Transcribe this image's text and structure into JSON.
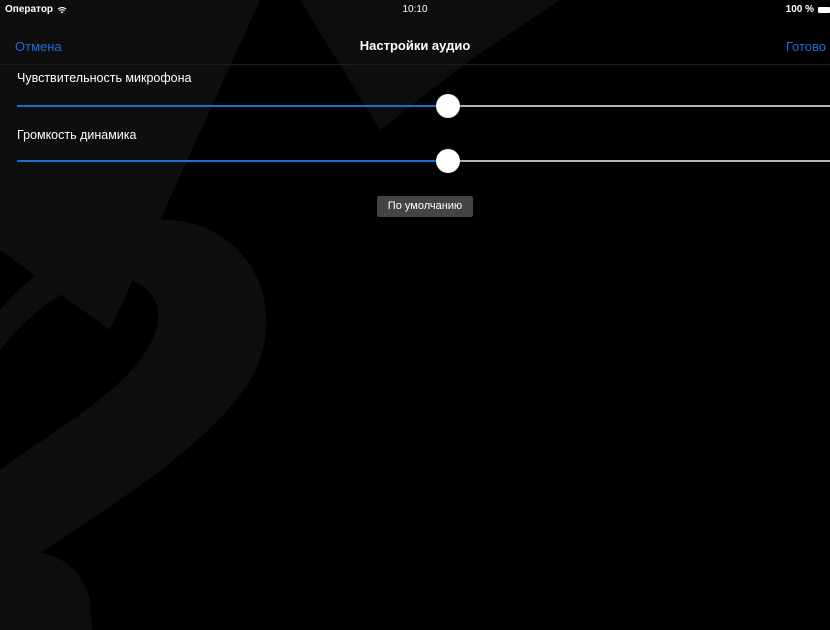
{
  "status_bar": {
    "carrier": "Оператор",
    "wifi_icon": "wifi-icon",
    "time": "10:10",
    "battery": "100 %",
    "battery_icon": "battery-icon"
  },
  "nav_bar": {
    "cancel_label": "Отмена",
    "title": "Настройки аудио",
    "done_label": "Готово"
  },
  "settings": [
    {
      "label": "Чувствительность микрофона",
      "value": 0.53
    },
    {
      "label": "Громкость динамика",
      "value": 0.53
    }
  ],
  "default_button_label": "По умолчанию",
  "colors": {
    "background": "#000000",
    "accent": "#1a6fd6",
    "track": "#b5b5b5",
    "button": "#444444",
    "text": "#ffffff"
  }
}
